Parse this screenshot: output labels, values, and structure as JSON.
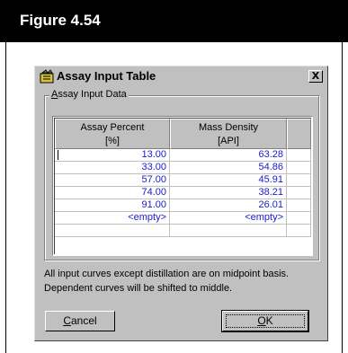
{
  "figure": {
    "title": "Figure 4.54"
  },
  "dialog": {
    "title": "Assay Input Table",
    "close_label": "X",
    "group_label_prefix": "A",
    "group_label_rest": "ssay Input Data",
    "columns": [
      {
        "line1": "Assay Percent",
        "line2": "[%]"
      },
      {
        "line1": "Mass Density",
        "line2": "[API]"
      }
    ],
    "rows": [
      {
        "assay_percent": "13.00",
        "mass_density": "63.28"
      },
      {
        "assay_percent": "33.00",
        "mass_density": "54.86"
      },
      {
        "assay_percent": "57.00",
        "mass_density": "45.91"
      },
      {
        "assay_percent": "74.00",
        "mass_density": "38.21"
      },
      {
        "assay_percent": "91.00",
        "mass_density": "26.01"
      },
      {
        "assay_percent": "<empty>",
        "mass_density": "<empty>"
      },
      {
        "assay_percent": "",
        "mass_density": ""
      }
    ],
    "note": "All input curves except distillation are on midpoint basis. Dependent curves will be shifted to middle.",
    "cancel_prefix": "C",
    "cancel_rest": "ancel",
    "ok_prefix": "O",
    "ok_rest": "K",
    "colors": {
      "value_text": "#1a1ad0",
      "face": "#c0c0c0"
    }
  }
}
